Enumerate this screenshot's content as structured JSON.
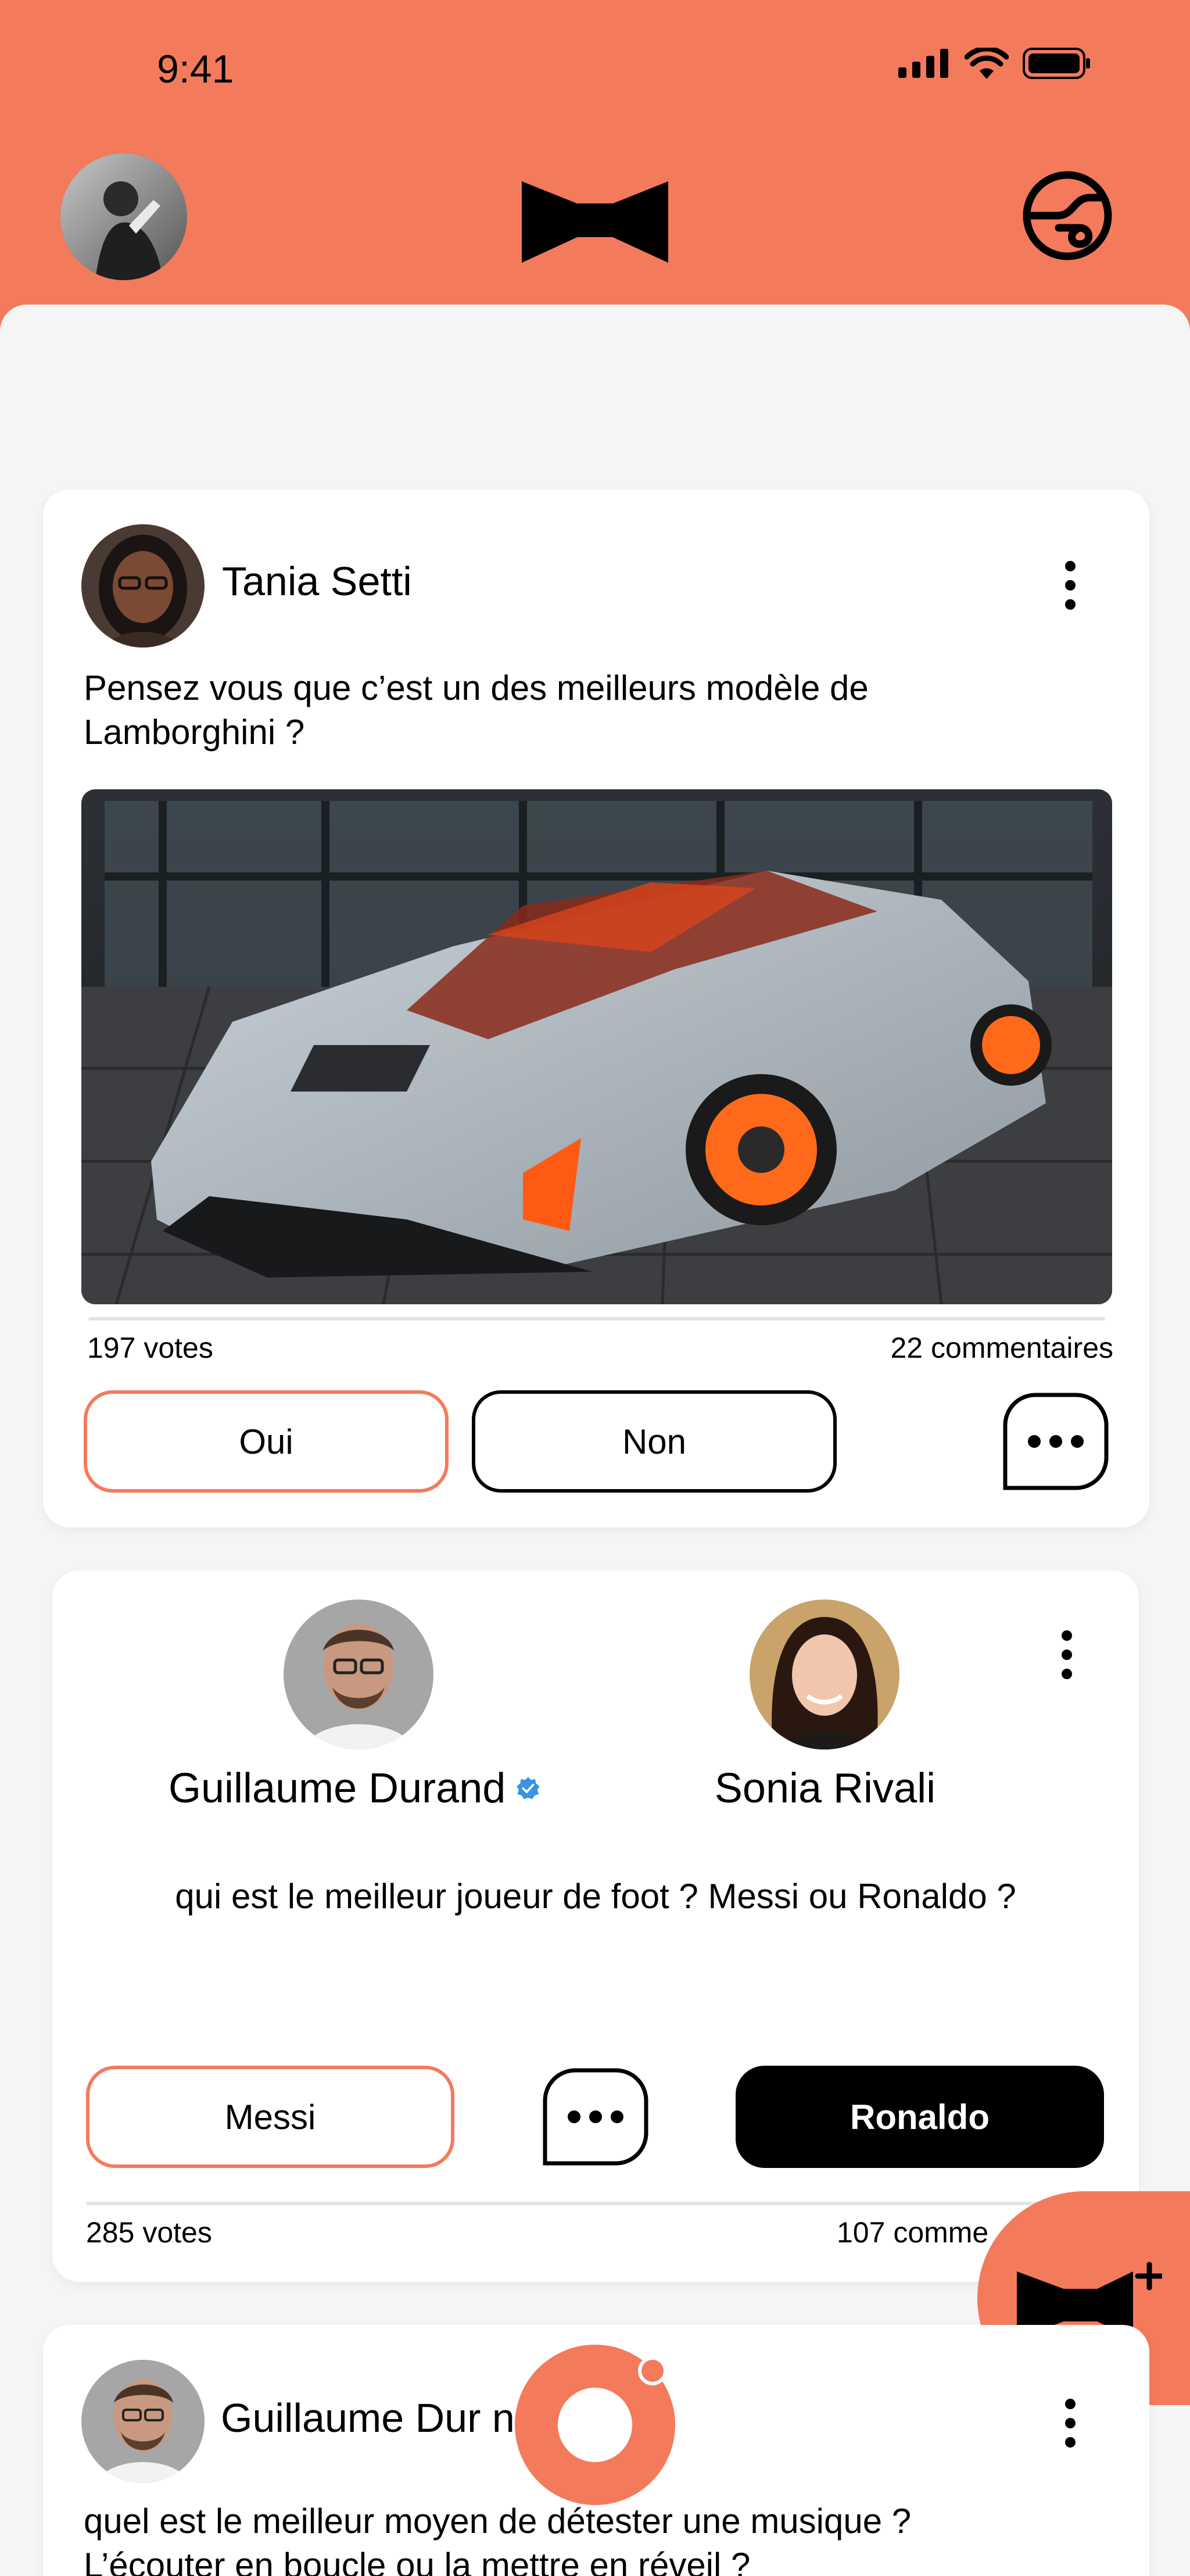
{
  "status_bar": {
    "time": "9:41"
  },
  "colors": {
    "accent": "#f47a5c",
    "background": "#f5f5f5",
    "card": "#ffffff"
  },
  "icons": {
    "header_left": "avatar",
    "header_center": "bowtie-logo-icon",
    "header_right": "profile-switch-icon",
    "post_menu": "more-vertical-icon",
    "comment": "comment-bubble-icon",
    "verified": "verified-badge-icon",
    "fab": "new-bowtie-post-icon"
  },
  "posts": [
    {
      "author": "Tania Setti",
      "question_line1": "Pensez vous que c’est un des meilleurs modèle de",
      "question_line2": "Lamborghini ?",
      "votes": "197 votes",
      "comments": "22 commentaires",
      "option_a": "Oui",
      "option_b": "Non"
    },
    {
      "author_left": "Guillaume Durand",
      "author_right": "Sonia Rivali",
      "question": "qui est le meilleur joueur de foot ? Messi ou Ronaldo ?",
      "option_a": "Messi",
      "option_b": "Ronaldo",
      "votes": "285 votes",
      "comments": "107 comme"
    },
    {
      "author": "Guillaume Dur    nd",
      "question_line1": "quel est le meilleur moyen de détester une musique ?",
      "question_line2": "L’écouter en boucle ou la mettre en réveil ?"
    }
  ]
}
